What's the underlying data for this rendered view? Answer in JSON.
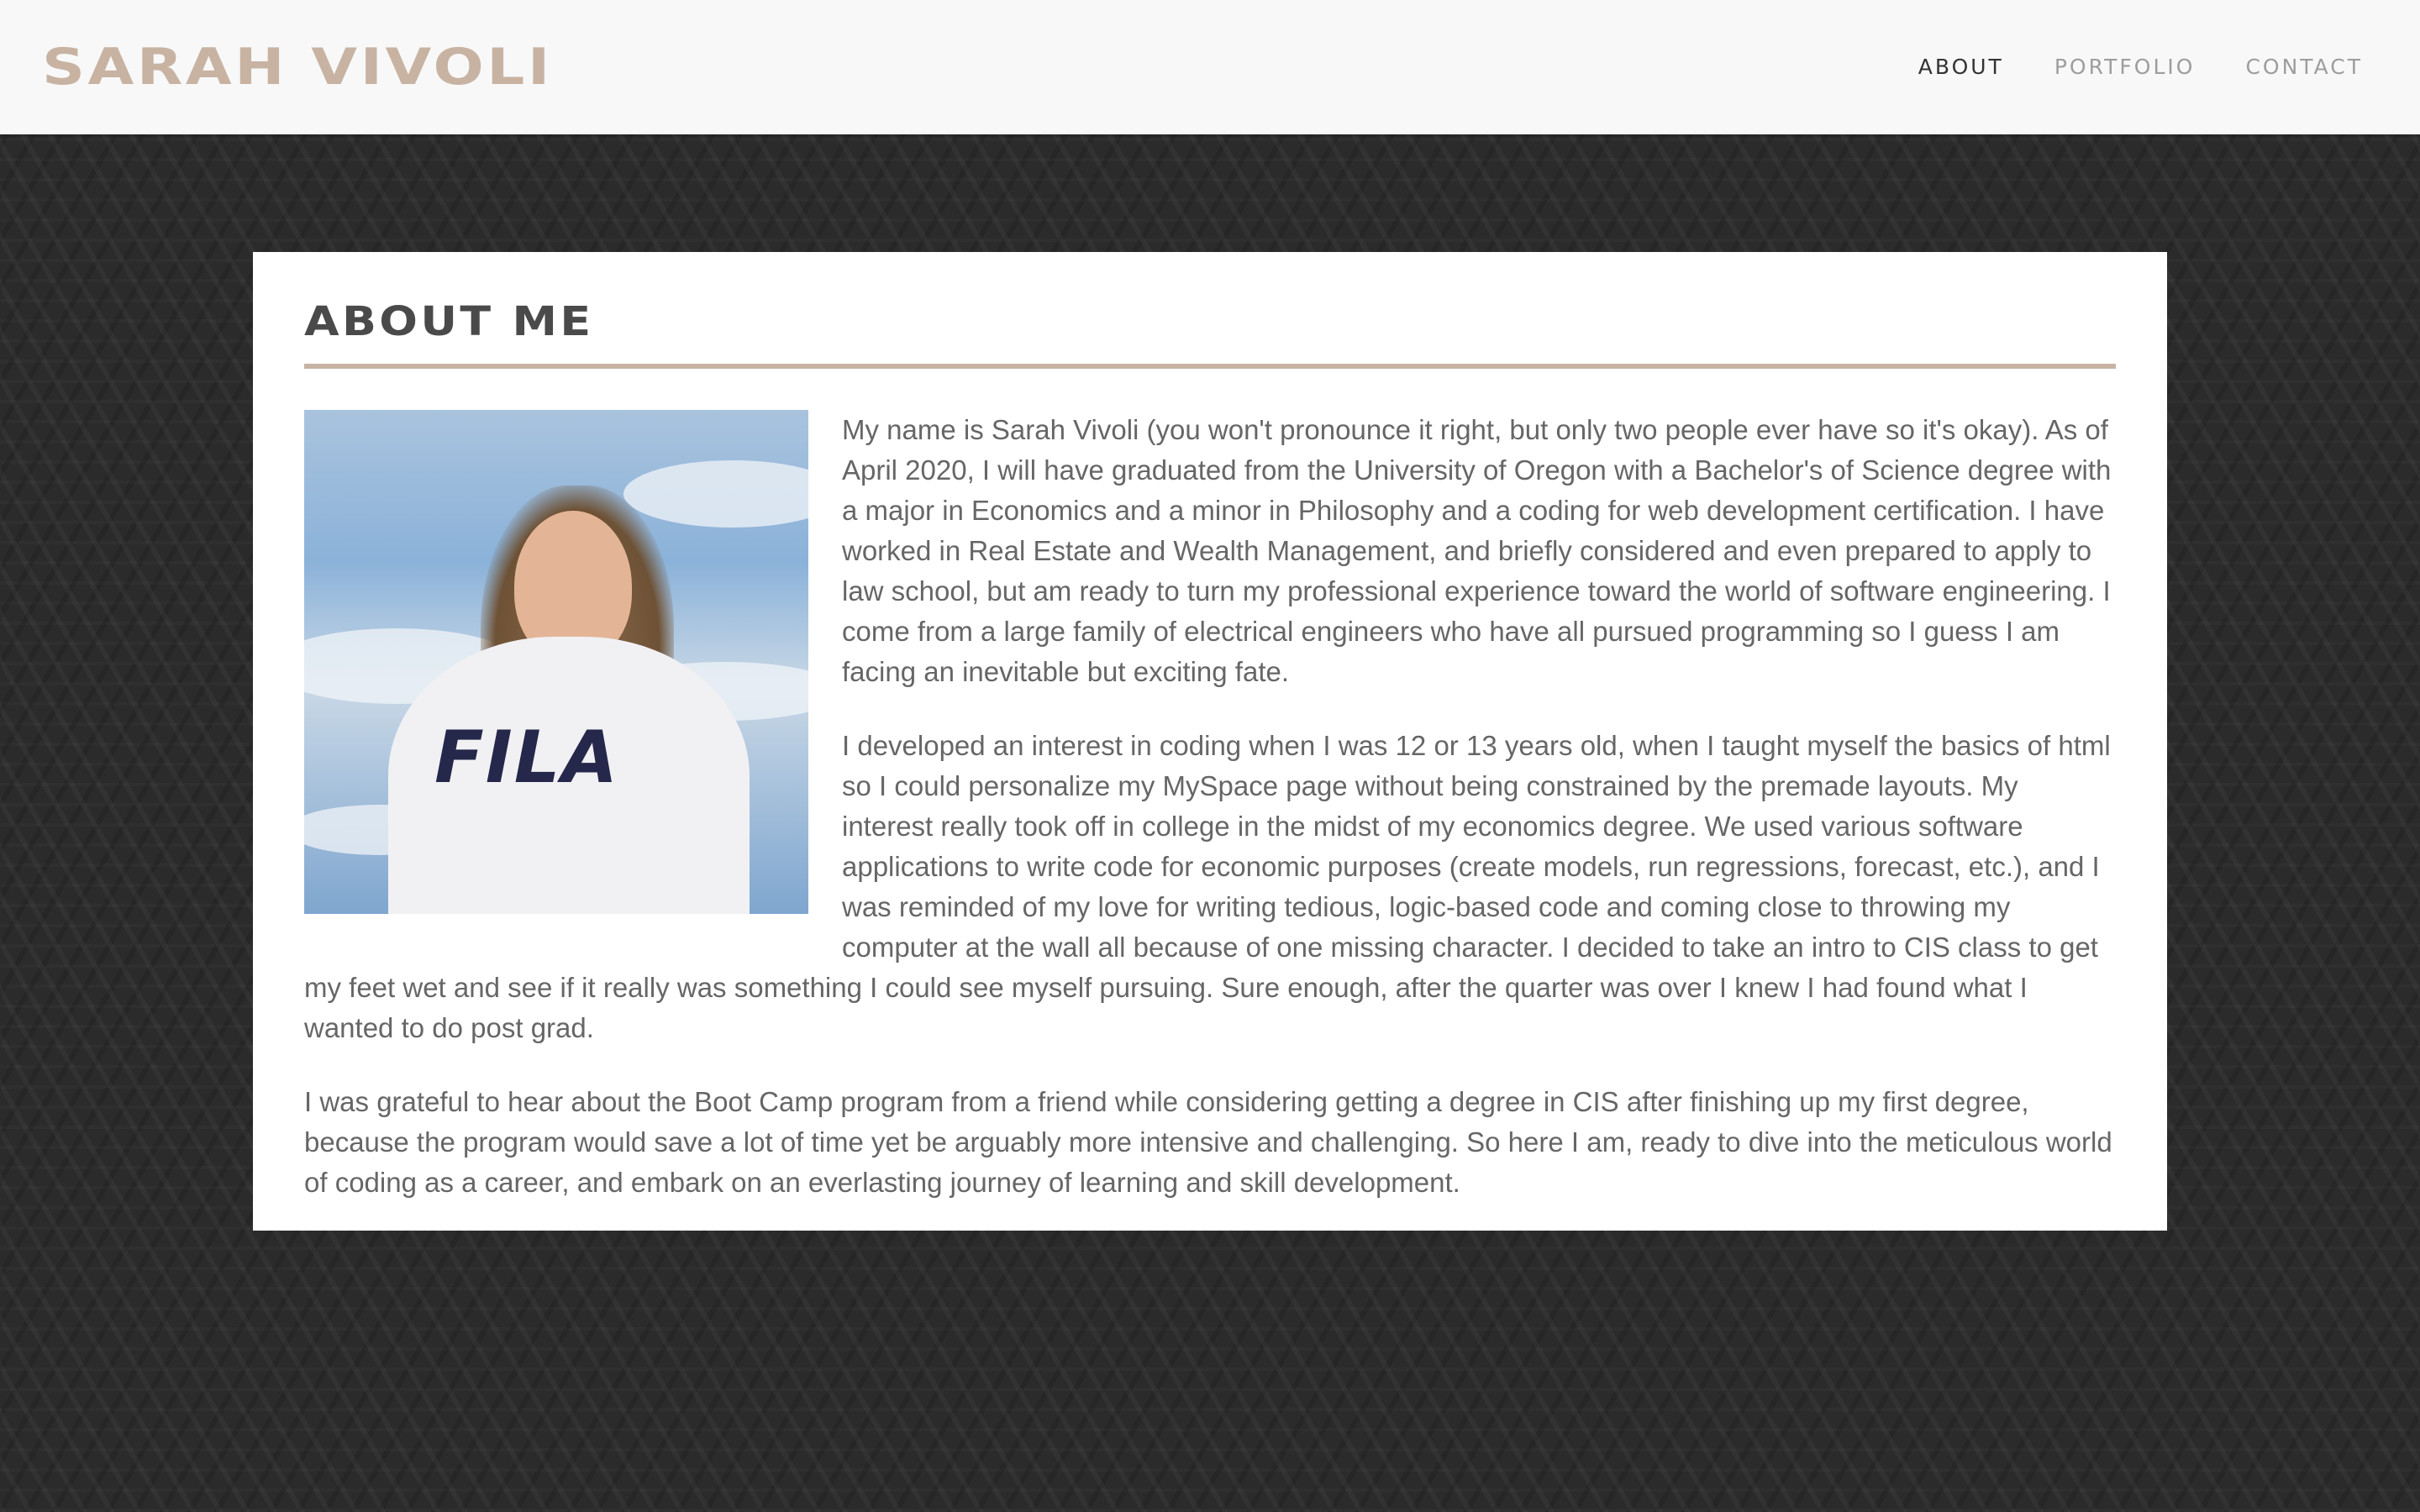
{
  "header": {
    "brand": "SARAH VIVOLI",
    "nav": [
      {
        "label": "ABOUT",
        "active": true
      },
      {
        "label": "PORTFOLIO",
        "active": false
      },
      {
        "label": "CONTACT",
        "active": false
      }
    ]
  },
  "about": {
    "title": "ABOUT ME",
    "photo_alt": "Photo of Sarah Vivoli",
    "photo_logo_text": "FILA",
    "paragraphs": [
      "My name is Sarah Vivoli (you won't pronounce it right, but only two people ever have so it's okay). As of April 2020, I will have graduated from the University of Oregon with a Bachelor's of Science degree with a major in Economics and a minor in Philosophy and a coding for web development certification. I have worked in Real Estate and Wealth Management, and briefly considered and even prepared to apply to law school, but am ready to turn my professional experience toward the world of software engineering. I come from a large family of electrical engineers who have all pursued programming so I guess I am facing an inevitable but exciting fate.",
      "I developed an interest in coding when I was 12 or 13 years old, when I taught myself the basics of html so I could personalize my MySpace page without being constrained by the premade layouts. My interest really took off in college in the midst of my economics degree. We used various software applications to write code for economic purposes (create models, run regressions, forecast, etc.), and I was reminded of my love for writing tedious, logic-based code and coming close to throwing my computer at the wall all because of one missing character. I decided to take an intro to CIS class to get my feet wet and see if it really was something I could see myself pursuing. Sure enough, after the quarter was over I knew I had found what I wanted to do post grad.",
      "I was grateful to hear about the Boot Camp program from a friend while considering getting a degree in CIS after finishing up my first degree, because the program would save a lot of time yet be arguably more intensive and challenging. So here I am, ready to dive into the meticulous world of coding as a career, and embark on an everlasting journey of learning and skill development."
    ]
  },
  "colors": {
    "accent": "#c8b3a3",
    "background": "#2b2b2b",
    "navbar": "#f8f8f8",
    "text": "#666666",
    "heading": "#4a4a4a"
  }
}
